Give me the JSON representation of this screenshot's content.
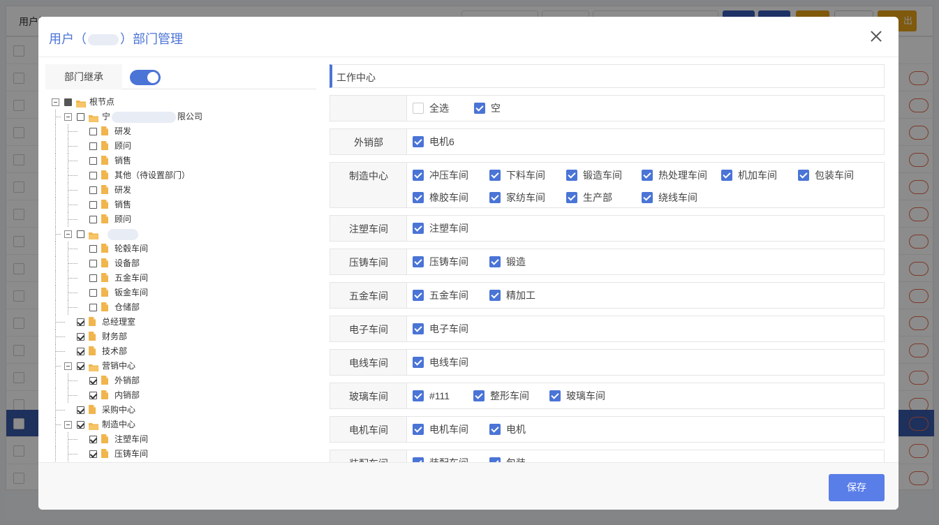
{
  "background": {
    "page_title": "用户管理",
    "buttons": [
      "#3a5bb8",
      "#3a5bb8",
      "#e8a317",
      "#ffffff",
      "#e8a317"
    ],
    "last_button_label": "出"
  },
  "modal": {
    "title_prefix": "用户（",
    "title_suffix": "）部门管理",
    "inherit_label": "部门继承",
    "inherit_on": true,
    "save_label": "保存"
  },
  "tree": [
    {
      "label": "根节点",
      "level": 0,
      "type": "folder",
      "check": "part",
      "toggle": true
    },
    {
      "label": "宁",
      "tail": "限公司",
      "level": 1,
      "type": "folder",
      "check": "off",
      "toggle": true,
      "blur": true
    },
    {
      "label": "研发",
      "level": 2,
      "type": "file",
      "check": "off"
    },
    {
      "label": "顾问",
      "level": 2,
      "type": "file",
      "check": "off"
    },
    {
      "label": "销售",
      "level": 2,
      "type": "file",
      "check": "off"
    },
    {
      "label": "其他（待设置部门）",
      "level": 2,
      "type": "file",
      "check": "off"
    },
    {
      "label": "研发",
      "level": 2,
      "type": "file",
      "check": "off"
    },
    {
      "label": "销售",
      "level": 2,
      "type": "file",
      "check": "off"
    },
    {
      "label": "顾问",
      "level": 2,
      "type": "file",
      "check": "off"
    },
    {
      "label": "",
      "level": 1,
      "type": "folder",
      "check": "off",
      "toggle": true,
      "blur": true
    },
    {
      "label": "轮毂车间",
      "level": 2,
      "type": "file",
      "check": "off"
    },
    {
      "label": "设备部",
      "level": 2,
      "type": "file",
      "check": "off"
    },
    {
      "label": "五金车间",
      "level": 2,
      "type": "file",
      "check": "off"
    },
    {
      "label": "钣金车间",
      "level": 2,
      "type": "file",
      "check": "off"
    },
    {
      "label": "仓储部",
      "level": 2,
      "type": "file",
      "check": "off"
    },
    {
      "label": "总经理室",
      "level": 1,
      "type": "file",
      "check": "on"
    },
    {
      "label": "财务部",
      "level": 1,
      "type": "file",
      "check": "on"
    },
    {
      "label": "技术部",
      "level": 1,
      "type": "file",
      "check": "on"
    },
    {
      "label": "营销中心",
      "level": 1,
      "type": "folder",
      "check": "on",
      "toggle": true
    },
    {
      "label": "外销部",
      "level": 2,
      "type": "file",
      "check": "on"
    },
    {
      "label": "内销部",
      "level": 2,
      "type": "file",
      "check": "on"
    },
    {
      "label": "采购中心",
      "level": 1,
      "type": "file",
      "check": "on"
    },
    {
      "label": "制造中心",
      "level": 1,
      "type": "folder",
      "check": "on",
      "toggle": true
    },
    {
      "label": "注塑车间",
      "level": 2,
      "type": "file",
      "check": "on"
    },
    {
      "label": "压铸车间",
      "level": 2,
      "type": "file",
      "check": "on"
    }
  ],
  "right": {
    "header": "工作中心",
    "groups": [
      {
        "label": "",
        "rows": [
          [
            {
              "t": "全选",
              "on": false
            },
            {
              "t": "空",
              "on": true
            }
          ]
        ]
      },
      {
        "label": "外销部",
        "rows": [
          [
            {
              "t": "电机6",
              "on": true
            }
          ]
        ]
      },
      {
        "label": "制造中心",
        "rows": [
          [
            {
              "t": "冲压车间",
              "on": true
            },
            {
              "t": "下料车间",
              "on": true
            },
            {
              "t": "锻造车间",
              "on": true
            },
            {
              "t": "热处理车间",
              "on": true
            },
            {
              "t": "机加车间",
              "on": true
            },
            {
              "t": "包装车间",
              "on": true
            }
          ],
          [
            {
              "t": "橡胶车间",
              "on": true
            },
            {
              "t": "家纺车间",
              "on": true
            },
            {
              "t": "生产部",
              "on": true
            },
            {
              "t": "绕线车间",
              "on": true
            }
          ]
        ]
      },
      {
        "label": "注塑车间",
        "rows": [
          [
            {
              "t": "注塑车间",
              "on": true
            }
          ]
        ]
      },
      {
        "label": "压铸车间",
        "rows": [
          [
            {
              "t": "压铸车间",
              "on": true
            },
            {
              "t": "锻造",
              "on": true
            }
          ]
        ]
      },
      {
        "label": "五金车间",
        "rows": [
          [
            {
              "t": "五金车间",
              "on": true
            },
            {
              "t": "精加工",
              "on": true
            }
          ]
        ]
      },
      {
        "label": "电子车间",
        "rows": [
          [
            {
              "t": "电子车间",
              "on": true
            }
          ]
        ]
      },
      {
        "label": "电线车间",
        "rows": [
          [
            {
              "t": "电线车间",
              "on": true
            }
          ]
        ]
      },
      {
        "label": "玻璃车间",
        "rows": [
          [
            {
              "t": "#111",
              "on": true
            },
            {
              "t": "整形车间",
              "on": true
            },
            {
              "t": "玻璃车间",
              "on": true
            }
          ]
        ]
      },
      {
        "label": "电机车间",
        "rows": [
          [
            {
              "t": "电机车间",
              "on": true
            },
            {
              "t": "电机",
              "on": true
            }
          ]
        ]
      },
      {
        "label": "装配车间",
        "rows": [
          [
            {
              "t": "装配车间",
              "on": true
            },
            {
              "t": "包装",
              "on": true
            }
          ]
        ]
      }
    ]
  }
}
